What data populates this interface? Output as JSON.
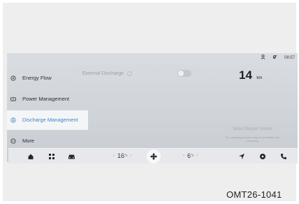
{
  "status_bar": {
    "time": "08:57",
    "icons": [
      "user-icon",
      "signal-icon"
    ]
  },
  "sidebar": {
    "items": [
      {
        "label": "Energy Flow",
        "icon": "energy-flow-icon",
        "active": false
      },
      {
        "label": "Power Management",
        "icon": "power-icon",
        "active": false
      },
      {
        "label": "Discharge Management",
        "icon": "discharge-icon",
        "active": true
      },
      {
        "label": "More",
        "icon": "more-icon",
        "active": false
      }
    ]
  },
  "external_discharge": {
    "label": "External Discharge",
    "toggle_on": false
  },
  "range": {
    "value": "14",
    "unit": "km"
  },
  "charger": {
    "button_label": "Slow Charger Unlock",
    "note": "The charging process may be terminated by unlocking"
  },
  "dock": {
    "left_temp": "16",
    "right_temp": "6",
    "deg_unit": "°c",
    "left_arrow": "‹",
    "right_arrow": "›"
  },
  "reference_code": "OMT26-1041",
  "colors": {
    "accent": "#3b86d6",
    "active_bg": "#f4f5f6"
  }
}
